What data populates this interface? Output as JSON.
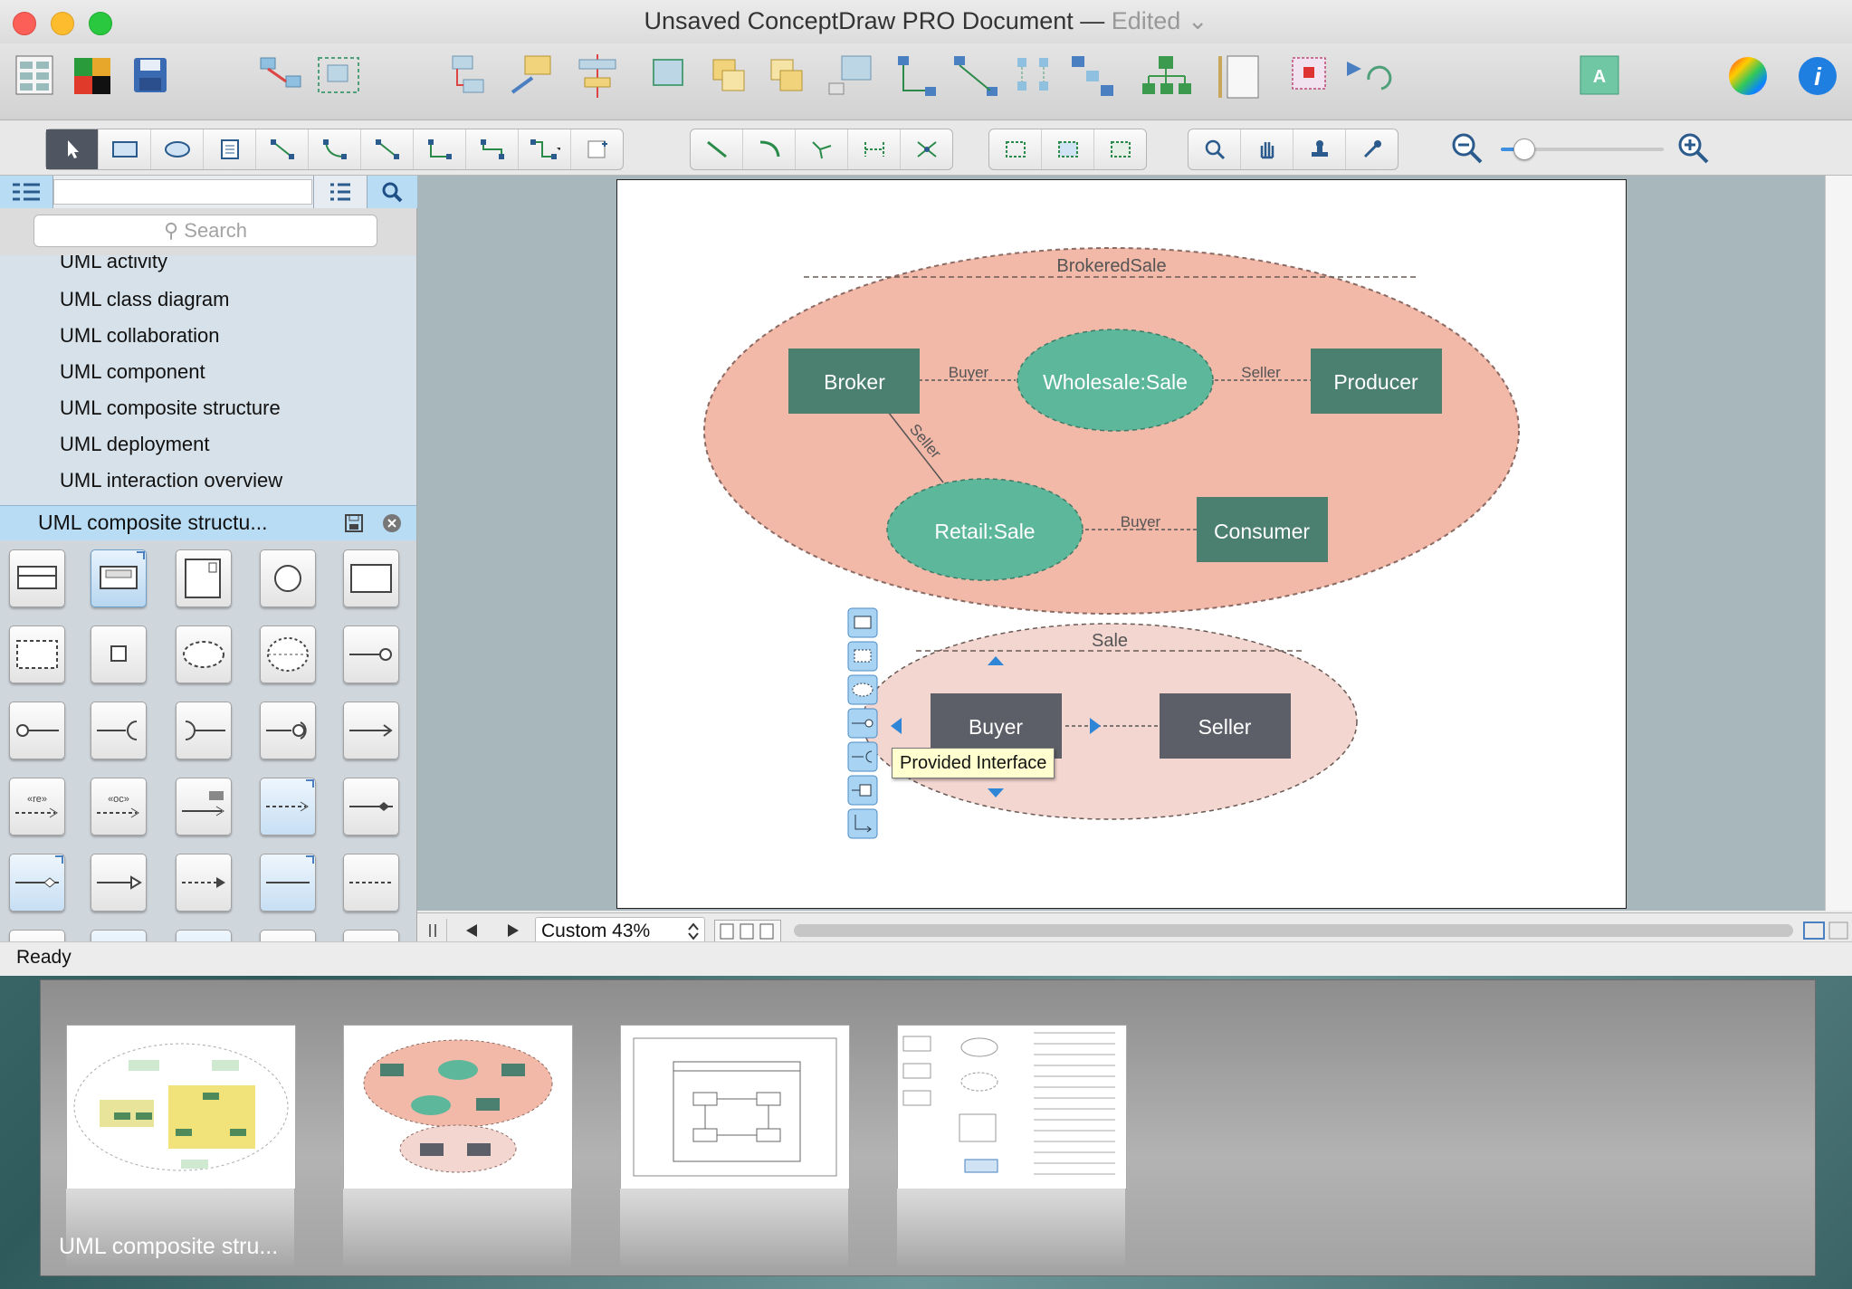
{
  "window": {
    "title": "Unsaved ConceptDraw PRO Document",
    "title_sep": " — ",
    "edited": "Edited"
  },
  "library": {
    "search_placeholder": "Search",
    "items": [
      "UML activity",
      "UML class diagram",
      "UML collaboration",
      "UML component",
      "UML composite structure",
      "UML deployment",
      "UML interaction overview"
    ],
    "open_library": "UML composite structu..."
  },
  "diagram": {
    "brokered_sale": {
      "title": "BrokeredSale",
      "nodes": {
        "broker": "Broker",
        "wholesale": "Wholesale:Sale",
        "producer": "Producer",
        "retail": "Retail:Sale",
        "consumer": "Consumer"
      },
      "roles": {
        "buyer_top": "Buyer",
        "seller_top": "Seller",
        "seller_diag": "Seller",
        "buyer_bottom": "Buyer"
      }
    },
    "sale": {
      "title": "Sale",
      "nodes": {
        "buyer": "Buyer",
        "seller": "Seller"
      }
    },
    "tooltip": "Provided Interface"
  },
  "bottombar": {
    "zoom_label": "Custom 43%"
  },
  "status": {
    "text": "Ready"
  },
  "thumbnails": {
    "caption": "UML composite stru..."
  },
  "colors": {
    "salmon": "#f2b8a8",
    "teal_dark": "#4b7f6f",
    "teal_light": "#5db79a",
    "gray_box": "#5c5f67",
    "pink_light": "#f4d6d0",
    "accent_blue": "#2f86d6"
  }
}
